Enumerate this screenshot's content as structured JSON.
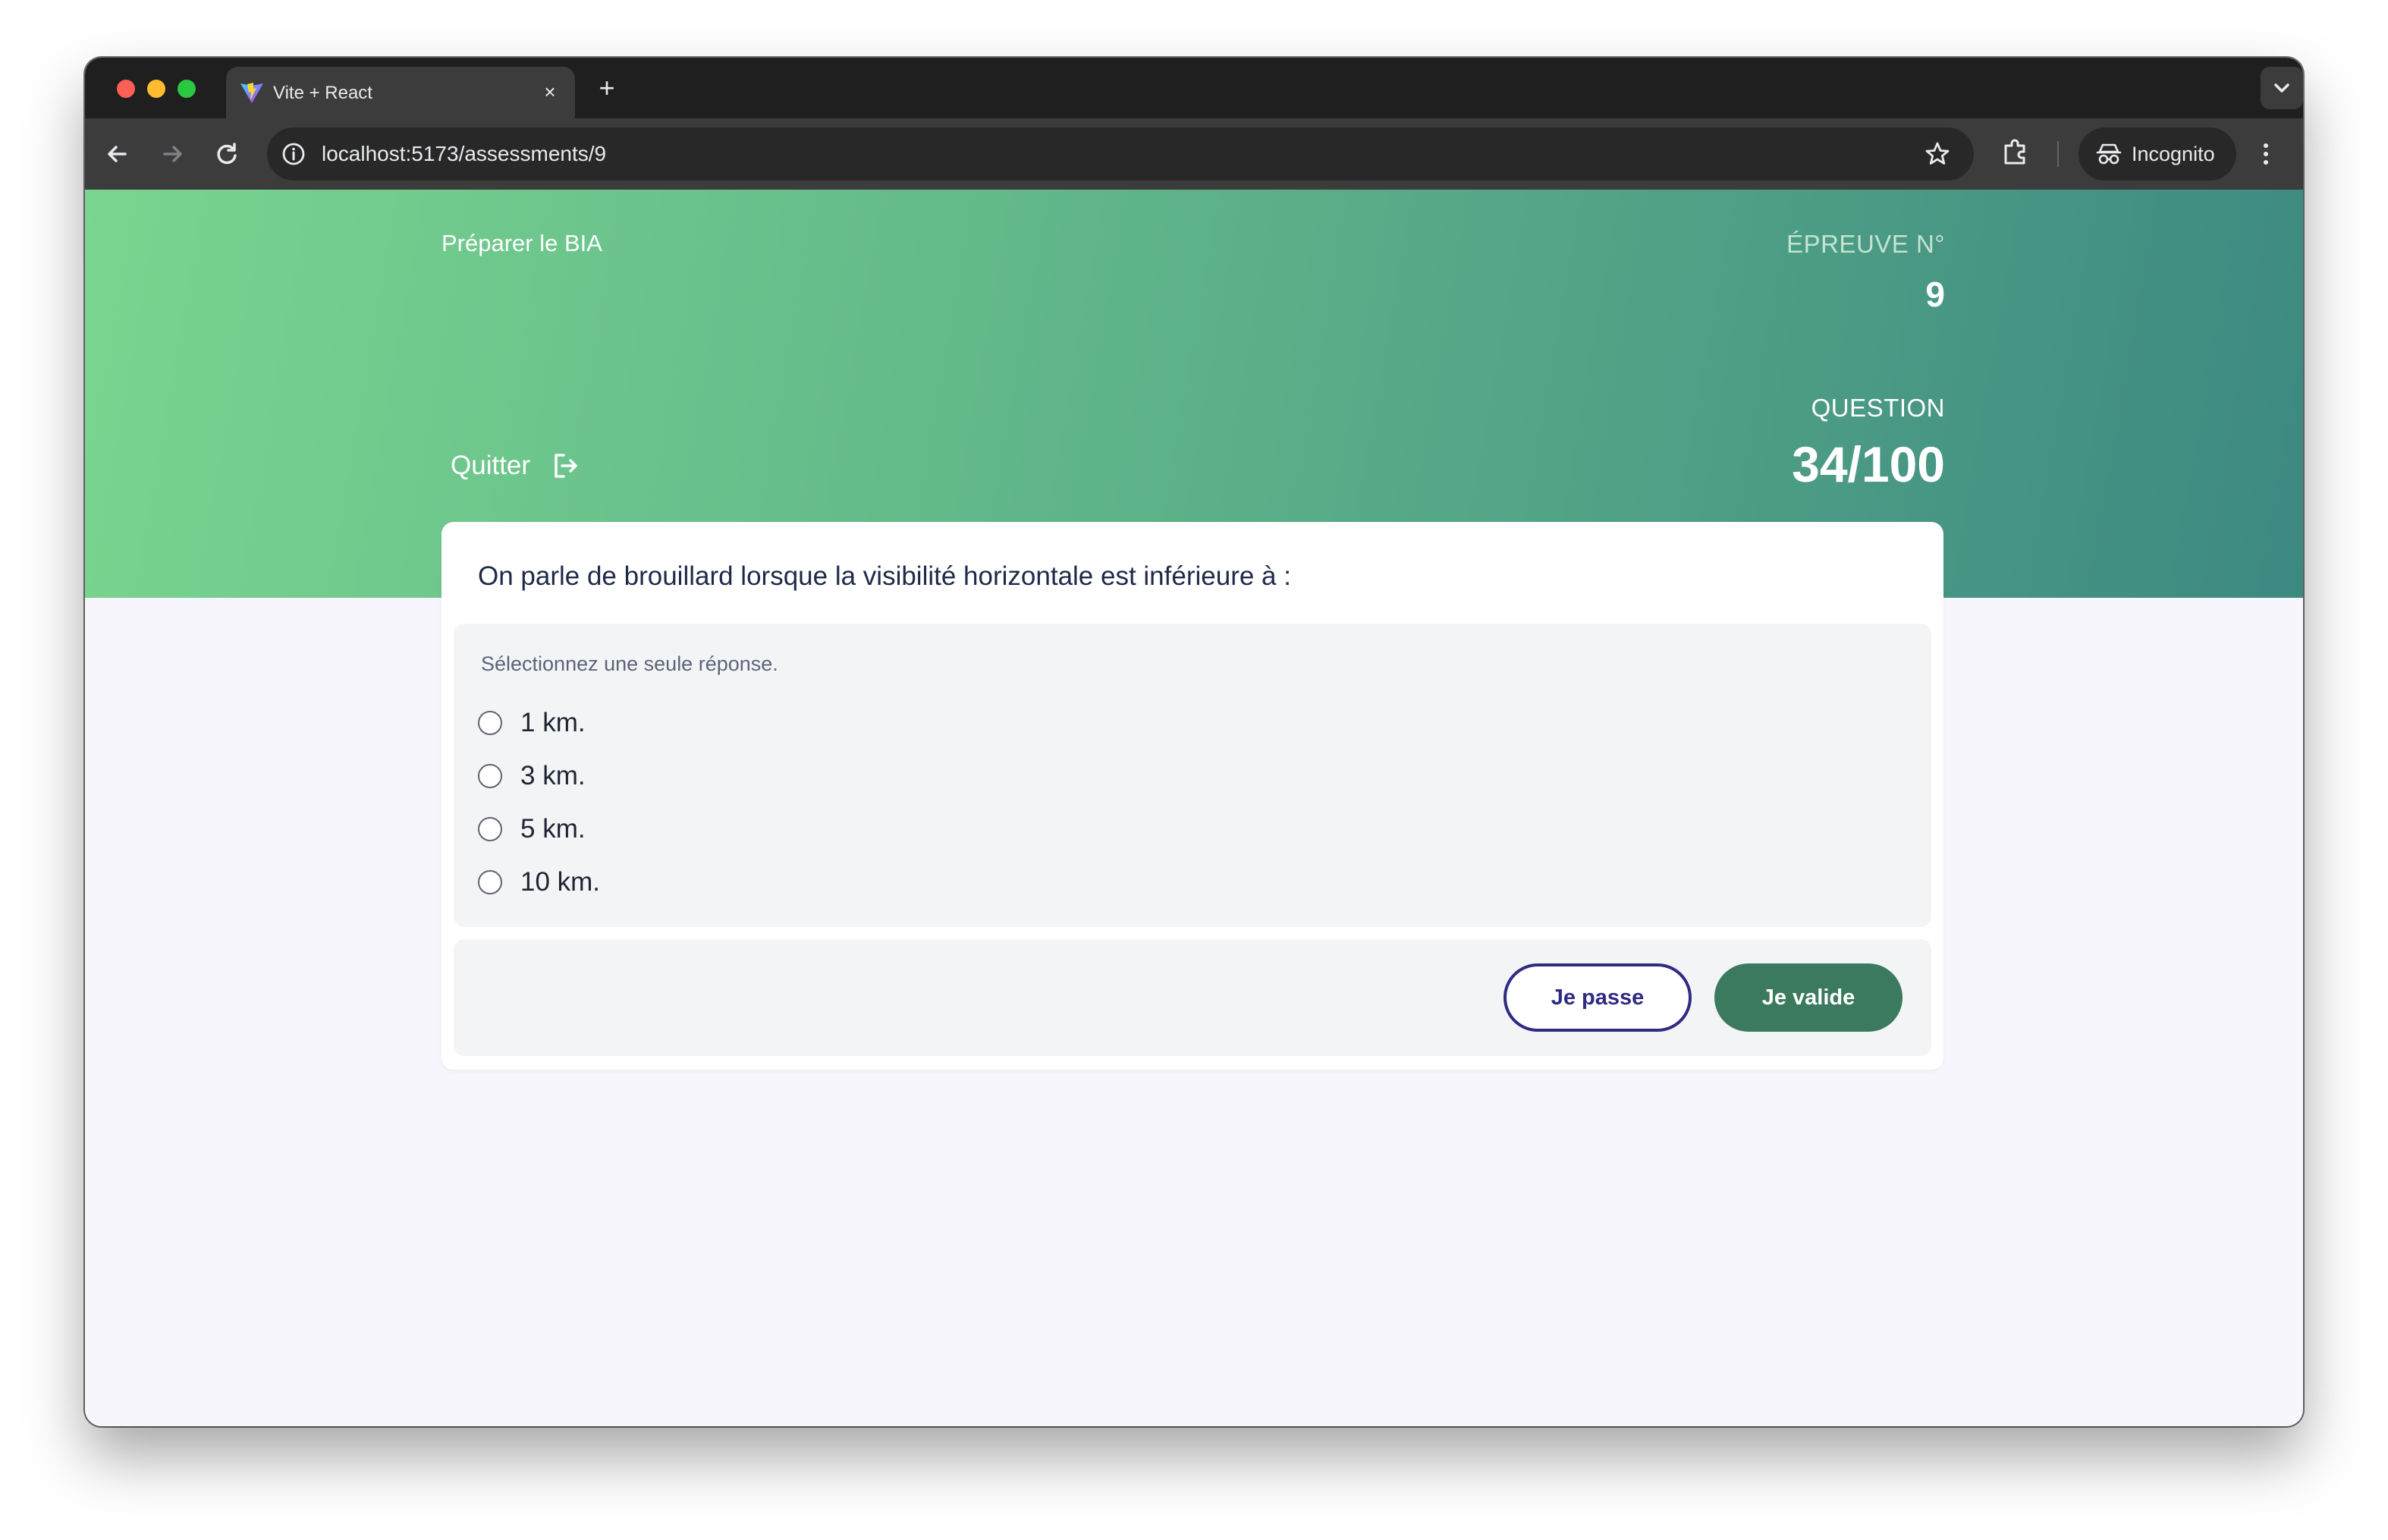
{
  "browser": {
    "tab_title": "Vite + React",
    "url": "localhost:5173/assessments/9",
    "incognito_label": "Incognito"
  },
  "header": {
    "course_title": "Préparer le BIA",
    "epreuve_label": "ÉPREUVE N°",
    "epreuve_number": "9",
    "quit_label": "Quitter",
    "question_label": "QUESTION",
    "question_count": "34/100"
  },
  "question": {
    "text": "On parle de brouillard lorsque la visibilité horizontale est inférieure à :",
    "hint": "Sélectionnez une seule réponse.",
    "options": [
      "1 km.",
      "3 km.",
      "5 km.",
      "10 km."
    ],
    "selected": null
  },
  "actions": {
    "skip_label": "Je passe",
    "validate_label": "Je valide"
  },
  "colors": {
    "hero_start": "#79d58f",
    "hero_end": "#3d8982",
    "skip_outline": "#2e2b82",
    "validate_bg": "#3b7a5e"
  }
}
